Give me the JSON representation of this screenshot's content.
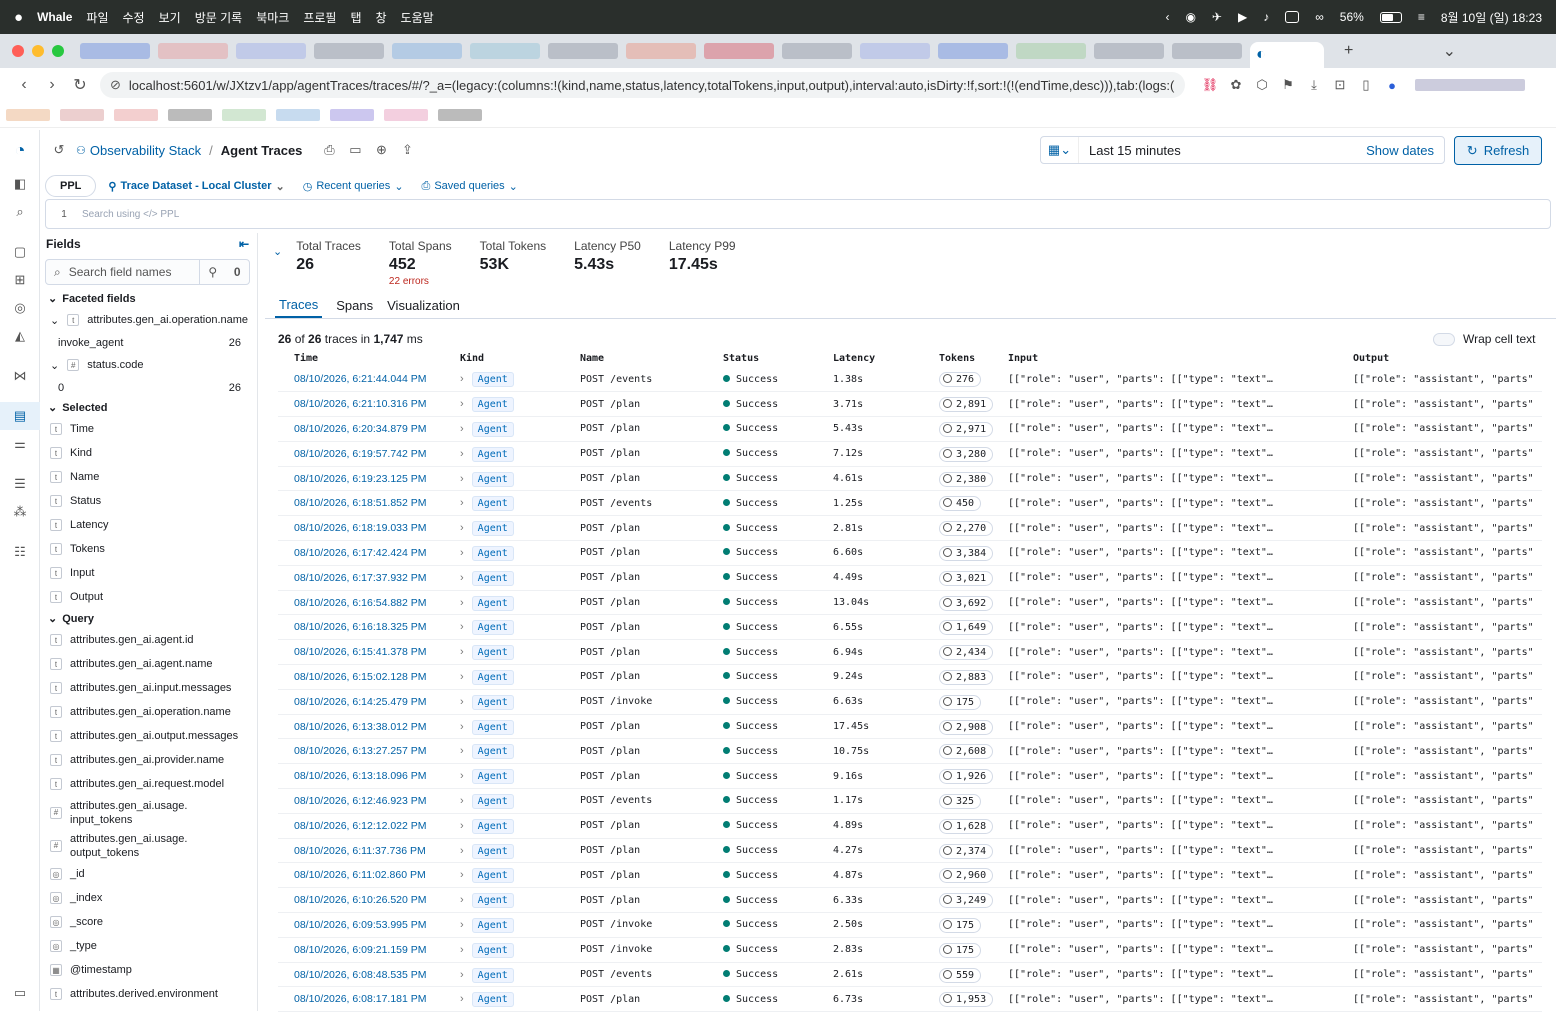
{
  "os": {
    "app_name": "Whale",
    "menus": [
      "파일",
      "수정",
      "보기",
      "방문 기록",
      "북마크",
      "프로필",
      "탭",
      "창",
      "도움말"
    ],
    "battery": "56%",
    "clock": "8월 10일 (일) 18:23"
  },
  "browser": {
    "url": "localhost:5601/w/JXtzv1/app/agentTraces/traces/#/?_a=(legacy:(columns:!(kind,name,status,latency,totalTokens,input,output),interval:auto,isDirty:!f,sort:!(!(endTime,desc))),tab:(logs:("
  },
  "breadcrumb": {
    "parent": "Observability Stack",
    "current": "Agent Traces"
  },
  "time": {
    "range": "Last 15 minutes",
    "show_dates": "Show dates",
    "refresh": "Refresh"
  },
  "query": {
    "language": "PPL",
    "dataset": "Trace Dataset - Local Cluster",
    "recent": "Recent queries",
    "saved": "Saved queries",
    "line_no": "1",
    "placeholder": "Search using </> PPL"
  },
  "fields": {
    "title": "Fields",
    "search_placeholder": "Search field names",
    "filter_count": "0",
    "faceted_label": "Faceted fields",
    "faceted": [
      {
        "name": "attributes.gen_ai.operation.name",
        "value": "invoke_agent",
        "count": "26"
      },
      {
        "name": "status.code",
        "value": "0",
        "count": "26"
      }
    ],
    "selected_label": "Selected",
    "selected": [
      "Time",
      "Kind",
      "Name",
      "Status",
      "Latency",
      "Tokens",
      "Input",
      "Output"
    ],
    "query_label": "Query",
    "query": [
      {
        "t": "t",
        "n": "attributes.gen_ai.agent.id"
      },
      {
        "t": "t",
        "n": "attributes.gen_ai.agent.name"
      },
      {
        "t": "t",
        "n": "attributes.gen_ai.input.messages"
      },
      {
        "t": "t",
        "n": "attributes.gen_ai.operation.name"
      },
      {
        "t": "t",
        "n": "attributes.gen_ai.output.messages"
      },
      {
        "t": "t",
        "n": "attributes.gen_ai.provider.name"
      },
      {
        "t": "t",
        "n": "attributes.gen_ai.request.model"
      },
      {
        "t": "#",
        "n": "attributes.gen_ai.usage.\ninput_tokens"
      },
      {
        "t": "#",
        "n": "attributes.gen_ai.usage.\noutput_tokens"
      },
      {
        "t": "◎",
        "n": "_id"
      },
      {
        "t": "◎",
        "n": "_index"
      },
      {
        "t": "◎",
        "n": "_score"
      },
      {
        "t": "◎",
        "n": "_type"
      },
      {
        "t": "▦",
        "n": "@timestamp"
      },
      {
        "t": "t",
        "n": "attributes.derived.environment"
      }
    ]
  },
  "stats": [
    {
      "label": "Total Traces",
      "value": "26"
    },
    {
      "label": "Total Spans",
      "value": "452",
      "sub": "22 errors"
    },
    {
      "label": "Total Tokens",
      "value": "53K"
    },
    {
      "label": "Latency P50",
      "value": "5.43s"
    },
    {
      "label": "Latency P99",
      "value": "17.45s"
    }
  ],
  "tabs": [
    "Traces",
    "Spans",
    "Visualization"
  ],
  "count": {
    "shown": "26",
    "of": " of ",
    "total": "26",
    "rest": " traces in ",
    "ms": "1,747",
    "unit": " ms"
  },
  "wrap_label": "Wrap cell text",
  "columns": [
    "Time",
    "Kind",
    "Name",
    "Status",
    "Latency",
    "Tokens",
    "Input",
    "Output"
  ],
  "input_text": "[[\"role\": \"user\", \"parts\": [[\"type\": \"text\"…",
  "output_text": "[[\"role\": \"assistant\", \"parts\"",
  "rows": [
    [
      "08/10/2026, 6:21:44.044 PM",
      "Agent",
      "POST /events",
      "Success",
      "1.38s",
      "276"
    ],
    [
      "08/10/2026, 6:21:10.316 PM",
      "Agent",
      "POST /plan",
      "Success",
      "3.71s",
      "2,891"
    ],
    [
      "08/10/2026, 6:20:34.879 PM",
      "Agent",
      "POST /plan",
      "Success",
      "5.43s",
      "2,971"
    ],
    [
      "08/10/2026, 6:19:57.742 PM",
      "Agent",
      "POST /plan",
      "Success",
      "7.12s",
      "3,280"
    ],
    [
      "08/10/2026, 6:19:23.125 PM",
      "Agent",
      "POST /plan",
      "Success",
      "4.61s",
      "2,380"
    ],
    [
      "08/10/2026, 6:18:51.852 PM",
      "Agent",
      "POST /events",
      "Success",
      "1.25s",
      "450"
    ],
    [
      "08/10/2026, 6:18:19.033 PM",
      "Agent",
      "POST /plan",
      "Success",
      "2.81s",
      "2,270"
    ],
    [
      "08/10/2026, 6:17:42.424 PM",
      "Agent",
      "POST /plan",
      "Success",
      "6.60s",
      "3,384"
    ],
    [
      "08/10/2026, 6:17:37.932 PM",
      "Agent",
      "POST /plan",
      "Success",
      "4.49s",
      "3,021"
    ],
    [
      "08/10/2026, 6:16:54.882 PM",
      "Agent",
      "POST /plan",
      "Success",
      "13.04s",
      "3,692"
    ],
    [
      "08/10/2026, 6:16:18.325 PM",
      "Agent",
      "POST /plan",
      "Success",
      "6.55s",
      "1,649"
    ],
    [
      "08/10/2026, 6:15:41.378 PM",
      "Agent",
      "POST /plan",
      "Success",
      "6.94s",
      "2,434"
    ],
    [
      "08/10/2026, 6:15:02.128 PM",
      "Agent",
      "POST /plan",
      "Success",
      "9.24s",
      "2,883"
    ],
    [
      "08/10/2026, 6:14:25.479 PM",
      "Agent",
      "POST /invoke",
      "Success",
      "6.63s",
      "175"
    ],
    [
      "08/10/2026, 6:13:38.012 PM",
      "Agent",
      "POST /plan",
      "Success",
      "17.45s",
      "2,908"
    ],
    [
      "08/10/2026, 6:13:27.257 PM",
      "Agent",
      "POST /plan",
      "Success",
      "10.75s",
      "2,608"
    ],
    [
      "08/10/2026, 6:13:18.096 PM",
      "Agent",
      "POST /plan",
      "Success",
      "9.16s",
      "1,926"
    ],
    [
      "08/10/2026, 6:12:46.923 PM",
      "Agent",
      "POST /events",
      "Success",
      "1.17s",
      "325"
    ],
    [
      "08/10/2026, 6:12:12.022 PM",
      "Agent",
      "POST /plan",
      "Success",
      "4.89s",
      "1,628"
    ],
    [
      "08/10/2026, 6:11:37.736 PM",
      "Agent",
      "POST /plan",
      "Success",
      "4.27s",
      "2,374"
    ],
    [
      "08/10/2026, 6:11:02.860 PM",
      "Agent",
      "POST /plan",
      "Success",
      "4.87s",
      "2,960"
    ],
    [
      "08/10/2026, 6:10:26.520 PM",
      "Agent",
      "POST /plan",
      "Success",
      "6.33s",
      "3,249"
    ],
    [
      "08/10/2026, 6:09:53.995 PM",
      "Agent",
      "POST /invoke",
      "Success",
      "2.50s",
      "175"
    ],
    [
      "08/10/2026, 6:09:21.159 PM",
      "Agent",
      "POST /invoke",
      "Success",
      "2.83s",
      "175"
    ],
    [
      "08/10/2026, 6:08:48.535 PM",
      "Agent",
      "POST /events",
      "Success",
      "2.61s",
      "559"
    ],
    [
      "08/10/2026, 6:08:17.181 PM",
      "Agent",
      "POST /plan",
      "Success",
      "6.73s",
      "1,953"
    ]
  ],
  "colors": {
    "accent": "#0061a6",
    "success": "#017d73",
    "error": "#bd271e"
  }
}
